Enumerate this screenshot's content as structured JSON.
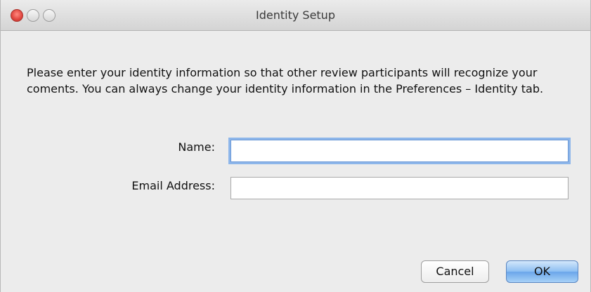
{
  "window": {
    "title": "Identity Setup",
    "controls": [
      "close-icon",
      "minimize-icon",
      "zoom-icon"
    ]
  },
  "message": "Please enter your identity information so that other review participants will recognize your coments. You can always change your identity information in the Preferences – Identity tab.",
  "form": {
    "name_label": "Name:",
    "name_value": "",
    "email_label": "Email Address:",
    "email_value": ""
  },
  "buttons": {
    "cancel": "Cancel",
    "ok": "OK"
  },
  "colors": {
    "close": "#e0443e",
    "focus_ring": "#8db6ea",
    "default_button": "#8dbef2"
  }
}
